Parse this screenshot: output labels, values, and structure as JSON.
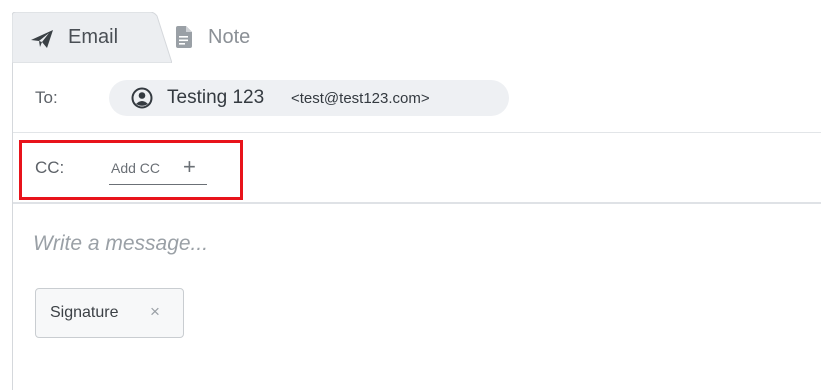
{
  "tabs": [
    {
      "label": "Email",
      "icon": "paper-plane-icon",
      "active": true
    },
    {
      "label": "Note",
      "icon": "note-icon",
      "active": false
    }
  ],
  "to": {
    "label": "To:",
    "recipient": {
      "name": "Testing 123",
      "email": "<test@test123.com>",
      "icon": "user-circle-icon"
    }
  },
  "cc": {
    "label": "CC:",
    "add_label": "Add CC",
    "add_icon": "+"
  },
  "message": {
    "placeholder": "Write a message..."
  },
  "signature": {
    "label": "Signature",
    "remove_icon": "×"
  },
  "colors": {
    "highlight": "#e8131b",
    "chip_bg": "#eef0f3"
  }
}
